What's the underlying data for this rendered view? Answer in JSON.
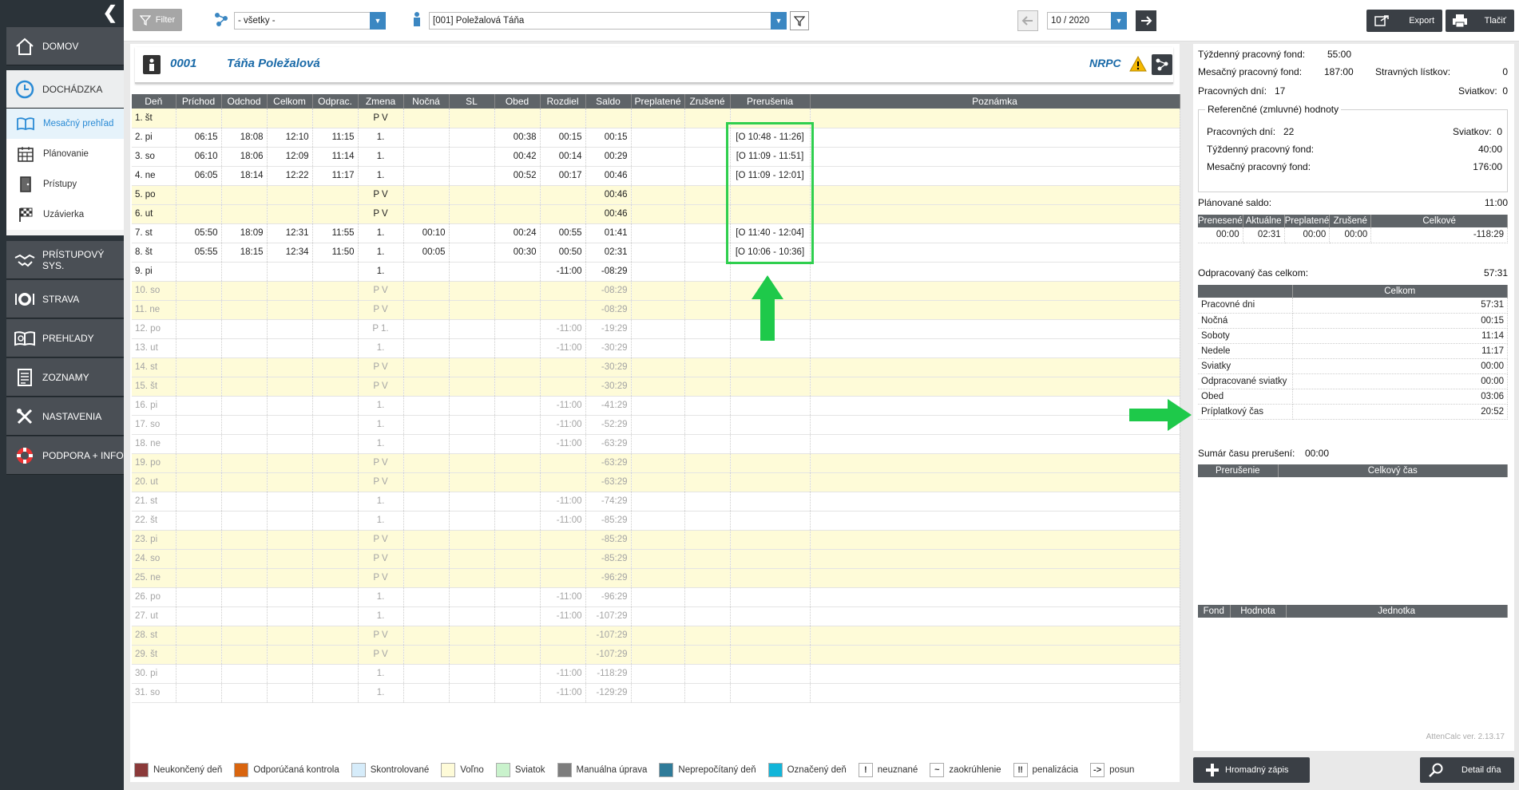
{
  "sidebar": {
    "home": "DOMOV",
    "attendance": "DOCHÁDZKA",
    "sub_items": [
      "Mesačný prehľad",
      "Plánovanie",
      "Prístupy",
      "Uzávierka"
    ],
    "access": "PRÍSTUPOVÝ SYS.",
    "food": "STRAVA",
    "overviews": "PREHĽADY",
    "lists": "ZOZNAMY",
    "settings": "NASTAVENIA",
    "support": "PODPORA + INFO"
  },
  "toolbar": {
    "filter_label": "Filter",
    "group_value": "- všetky -",
    "employee_value": "[001] Poležalová Táňa",
    "period_value": "10 / 2020",
    "export_label": "Export",
    "print_label": "Tlačiť"
  },
  "employee": {
    "id": "0001",
    "name": "Táňa Poležalová",
    "code": "NRPC"
  },
  "table": {
    "columns": [
      "Deň",
      "Príchod",
      "Odchod",
      "Celkom",
      "Odprac.",
      "Zmena",
      "Nočná",
      "SL",
      "Obed",
      "Rozdiel",
      "Saldo",
      "Preplatené",
      "Zrušené",
      "Prerušenia",
      "Poznámka"
    ],
    "rows": [
      {
        "d": "1. št",
        "pri": "",
        "odc": "",
        "cel": "",
        "odp": "",
        "zm": "P V",
        "no": "",
        "sl": "",
        "ob": "",
        "roz": "",
        "sal": "",
        "pre": "",
        "zr": "",
        "per": "",
        "poz": "",
        "t": "free"
      },
      {
        "d": "2. pi",
        "pri": "06:15",
        "odc": "18:08",
        "cel": "12:10",
        "odp": "11:15",
        "zm": "1.",
        "no": "",
        "sl": "",
        "ob": "00:38",
        "roz": "00:15",
        "sal": "00:15",
        "pre": "",
        "zr": "",
        "per": "[O 10:48 - 11:26]",
        "poz": "",
        "t": "work"
      },
      {
        "d": "3. so",
        "pri": "06:10",
        "odc": "18:06",
        "cel": "12:09",
        "odp": "11:14",
        "zm": "1.",
        "no": "",
        "sl": "",
        "ob": "00:42",
        "roz": "00:14",
        "sal": "00:29",
        "pre": "",
        "zr": "",
        "per": "[O 11:09 - 11:51]",
        "poz": "",
        "t": "work"
      },
      {
        "d": "4. ne",
        "pri": "06:05",
        "odc": "18:14",
        "cel": "12:22",
        "odp": "11:17",
        "zm": "1.",
        "no": "",
        "sl": "",
        "ob": "00:52",
        "roz": "00:17",
        "sal": "00:46",
        "pre": "",
        "zr": "",
        "per": "[O 11:09 - 12:01]",
        "poz": "",
        "t": "work"
      },
      {
        "d": "5. po",
        "pri": "",
        "odc": "",
        "cel": "",
        "odp": "",
        "zm": "P V",
        "no": "",
        "sl": "",
        "ob": "",
        "roz": "",
        "sal": "00:46",
        "pre": "",
        "zr": "",
        "per": "",
        "poz": "",
        "t": "free"
      },
      {
        "d": "6. ut",
        "pri": "",
        "odc": "",
        "cel": "",
        "odp": "",
        "zm": "P V",
        "no": "",
        "sl": "",
        "ob": "",
        "roz": "",
        "sal": "00:46",
        "pre": "",
        "zr": "",
        "per": "",
        "poz": "",
        "t": "free"
      },
      {
        "d": "7. st",
        "pri": "05:50",
        "odc": "18:09",
        "cel": "12:31",
        "odp": "11:55",
        "zm": "1.",
        "no": "00:10",
        "sl": "",
        "ob": "00:24",
        "roz": "00:55",
        "sal": "01:41",
        "pre": "",
        "zr": "",
        "per": "[O 11:40 - 12:04]",
        "poz": "",
        "t": "work"
      },
      {
        "d": "8. št",
        "pri": "05:55",
        "odc": "18:15",
        "cel": "12:34",
        "odp": "11:50",
        "zm": "1.",
        "no": "00:05",
        "sl": "",
        "ob": "00:30",
        "roz": "00:50",
        "sal": "02:31",
        "pre": "",
        "zr": "",
        "per": "[O 10:06 - 10:36]",
        "poz": "",
        "t": "work"
      },
      {
        "d": "9. pi",
        "pri": "",
        "odc": "",
        "cel": "",
        "odp": "",
        "zm": "1.",
        "no": "",
        "sl": "",
        "ob": "",
        "roz": "-11:00",
        "sal": "-08:29",
        "pre": "",
        "zr": "",
        "per": "",
        "poz": "",
        "t": "work"
      },
      {
        "d": "10. so",
        "pri": "",
        "odc": "",
        "cel": "",
        "odp": "",
        "zm": "P V",
        "no": "",
        "sl": "",
        "ob": "",
        "roz": "",
        "sal": "-08:29",
        "pre": "",
        "zr": "",
        "per": "",
        "poz": "",
        "t": "free future"
      },
      {
        "d": "11. ne",
        "pri": "",
        "odc": "",
        "cel": "",
        "odp": "",
        "zm": "P V",
        "no": "",
        "sl": "",
        "ob": "",
        "roz": "",
        "sal": "-08:29",
        "pre": "",
        "zr": "",
        "per": "",
        "poz": "",
        "t": "free future"
      },
      {
        "d": "12. po",
        "pri": "",
        "odc": "",
        "cel": "",
        "odp": "",
        "zm": "P 1.",
        "no": "",
        "sl": "",
        "ob": "",
        "roz": "-11:00",
        "sal": "-19:29",
        "pre": "",
        "zr": "",
        "per": "",
        "poz": "",
        "t": "future"
      },
      {
        "d": "13. ut",
        "pri": "",
        "odc": "",
        "cel": "",
        "odp": "",
        "zm": "1.",
        "no": "",
        "sl": "",
        "ob": "",
        "roz": "-11:00",
        "sal": "-30:29",
        "pre": "",
        "zr": "",
        "per": "",
        "poz": "",
        "t": "future"
      },
      {
        "d": "14. st",
        "pri": "",
        "odc": "",
        "cel": "",
        "odp": "",
        "zm": "P V",
        "no": "",
        "sl": "",
        "ob": "",
        "roz": "",
        "sal": "-30:29",
        "pre": "",
        "zr": "",
        "per": "",
        "poz": "",
        "t": "free future"
      },
      {
        "d": "15. št",
        "pri": "",
        "odc": "",
        "cel": "",
        "odp": "",
        "zm": "P V",
        "no": "",
        "sl": "",
        "ob": "",
        "roz": "",
        "sal": "-30:29",
        "pre": "",
        "zr": "",
        "per": "",
        "poz": "",
        "t": "free future"
      },
      {
        "d": "16. pi",
        "pri": "",
        "odc": "",
        "cel": "",
        "odp": "",
        "zm": "1.",
        "no": "",
        "sl": "",
        "ob": "",
        "roz": "-11:00",
        "sal": "-41:29",
        "pre": "",
        "zr": "",
        "per": "",
        "poz": "",
        "t": "future"
      },
      {
        "d": "17. so",
        "pri": "",
        "odc": "",
        "cel": "",
        "odp": "",
        "zm": "1.",
        "no": "",
        "sl": "",
        "ob": "",
        "roz": "-11:00",
        "sal": "-52:29",
        "pre": "",
        "zr": "",
        "per": "",
        "poz": "",
        "t": "future"
      },
      {
        "d": "18. ne",
        "pri": "",
        "odc": "",
        "cel": "",
        "odp": "",
        "zm": "1.",
        "no": "",
        "sl": "",
        "ob": "",
        "roz": "-11:00",
        "sal": "-63:29",
        "pre": "",
        "zr": "",
        "per": "",
        "poz": "",
        "t": "future"
      },
      {
        "d": "19. po",
        "pri": "",
        "odc": "",
        "cel": "",
        "odp": "",
        "zm": "P V",
        "no": "",
        "sl": "",
        "ob": "",
        "roz": "",
        "sal": "-63:29",
        "pre": "",
        "zr": "",
        "per": "",
        "poz": "",
        "t": "free future"
      },
      {
        "d": "20. ut",
        "pri": "",
        "odc": "",
        "cel": "",
        "odp": "",
        "zm": "P V",
        "no": "",
        "sl": "",
        "ob": "",
        "roz": "",
        "sal": "-63:29",
        "pre": "",
        "zr": "",
        "per": "",
        "poz": "",
        "t": "free future"
      },
      {
        "d": "21. st",
        "pri": "",
        "odc": "",
        "cel": "",
        "odp": "",
        "zm": "1.",
        "no": "",
        "sl": "",
        "ob": "",
        "roz": "-11:00",
        "sal": "-74:29",
        "pre": "",
        "zr": "",
        "per": "",
        "poz": "",
        "t": "future"
      },
      {
        "d": "22. št",
        "pri": "",
        "odc": "",
        "cel": "",
        "odp": "",
        "zm": "1.",
        "no": "",
        "sl": "",
        "ob": "",
        "roz": "-11:00",
        "sal": "-85:29",
        "pre": "",
        "zr": "",
        "per": "",
        "poz": "",
        "t": "future"
      },
      {
        "d": "23. pi",
        "pri": "",
        "odc": "",
        "cel": "",
        "odp": "",
        "zm": "P V",
        "no": "",
        "sl": "",
        "ob": "",
        "roz": "",
        "sal": "-85:29",
        "pre": "",
        "zr": "",
        "per": "",
        "poz": "",
        "t": "free future"
      },
      {
        "d": "24. so",
        "pri": "",
        "odc": "",
        "cel": "",
        "odp": "",
        "zm": "P V",
        "no": "",
        "sl": "",
        "ob": "",
        "roz": "",
        "sal": "-85:29",
        "pre": "",
        "zr": "",
        "per": "",
        "poz": "",
        "t": "free future"
      },
      {
        "d": "25. ne",
        "pri": "",
        "odc": "",
        "cel": "",
        "odp": "",
        "zm": "P V",
        "no": "",
        "sl": "",
        "ob": "",
        "roz": "",
        "sal": "-96:29",
        "pre": "",
        "zr": "",
        "per": "",
        "poz": "",
        "t": "free future"
      },
      {
        "d": "26. po",
        "pri": "",
        "odc": "",
        "cel": "",
        "odp": "",
        "zm": "1.",
        "no": "",
        "sl": "",
        "ob": "",
        "roz": "-11:00",
        "sal": "-96:29",
        "pre": "",
        "zr": "",
        "per": "",
        "poz": "",
        "t": "future"
      },
      {
        "d": "27. ut",
        "pri": "",
        "odc": "",
        "cel": "",
        "odp": "",
        "zm": "1.",
        "no": "",
        "sl": "",
        "ob": "",
        "roz": "-11:00",
        "sal": "-107:29",
        "pre": "",
        "zr": "",
        "per": "",
        "poz": "",
        "t": "future"
      },
      {
        "d": "28. st",
        "pri": "",
        "odc": "",
        "cel": "",
        "odp": "",
        "zm": "P V",
        "no": "",
        "sl": "",
        "ob": "",
        "roz": "",
        "sal": "-107:29",
        "pre": "",
        "zr": "",
        "per": "",
        "poz": "",
        "t": "free future"
      },
      {
        "d": "29. št",
        "pri": "",
        "odc": "",
        "cel": "",
        "odp": "",
        "zm": "P V",
        "no": "",
        "sl": "",
        "ob": "",
        "roz": "",
        "sal": "-107:29",
        "pre": "",
        "zr": "",
        "per": "",
        "poz": "",
        "t": "free future"
      },
      {
        "d": "30. pi",
        "pri": "",
        "odc": "",
        "cel": "",
        "odp": "",
        "zm": "1.",
        "no": "",
        "sl": "",
        "ob": "",
        "roz": "-11:00",
        "sal": "-118:29",
        "pre": "",
        "zr": "",
        "per": "",
        "poz": "",
        "t": "future"
      },
      {
        "d": "31. so",
        "pri": "",
        "odc": "",
        "cel": "",
        "odp": "",
        "zm": "1.",
        "no": "",
        "sl": "",
        "ob": "",
        "roz": "-11:00",
        "sal": "-129:29",
        "pre": "",
        "zr": "",
        "per": "",
        "poz": "",
        "t": "future"
      }
    ]
  },
  "legend": [
    {
      "label": "Neukončený deň",
      "color": "#8b3a3a",
      "mark": ""
    },
    {
      "label": "Odporúčaná kontrola",
      "color": "#d9650f",
      "mark": ""
    },
    {
      "label": "Skontrolované",
      "color": "#d6ecfa",
      "mark": ""
    },
    {
      "label": "Voľno",
      "color": "#fefbd8",
      "mark": ""
    },
    {
      "label": "Sviatok",
      "color": "#c9f2cc",
      "mark": ""
    },
    {
      "label": "Manuálna úprava",
      "color": "#7d7d7d",
      "mark": ""
    },
    {
      "label": "Neprepočítaný deň",
      "color": "#2f7b99",
      "mark": ""
    },
    {
      "label": "Označený deň",
      "color": "#12b5d9",
      "mark": ""
    },
    {
      "label": "neuznané",
      "color": "#ffffff",
      "mark": "!"
    },
    {
      "label": "zaokrúhlenie",
      "color": "#ffffff",
      "mark": "~"
    },
    {
      "label": "penalizácia",
      "color": "#ffffff",
      "mark": "‼"
    },
    {
      "label": "posun",
      "color": "#ffffff",
      "mark": "->"
    }
  ],
  "summary": {
    "weekly_fund_label": "Týždenný pracovný fond:",
    "weekly_fund_value": "55:00",
    "monthly_fund_label": "Mesačný pracovný fond:",
    "monthly_fund_value": "187:00",
    "meal_label": "Stravných lístkov:",
    "meal_value": "0",
    "workdays_label": "Pracovných dní:",
    "workdays_value": "17",
    "holidays_label": "Sviatkov:",
    "holidays_value": "0",
    "ref_title": "Referenčné (zmluvné) hodnoty",
    "ref_workdays_label": "Pracovných dní:",
    "ref_workdays_value": "22",
    "ref_holidays_label": "Sviatkov:",
    "ref_holidays_value": "0",
    "ref_weekly_label": "Týždenný pracovný fond:",
    "ref_weekly_value": "40:00",
    "ref_monthly_label": "Mesačný pracovný fond:",
    "ref_monthly_value": "176:00",
    "planned_label": "Plánované saldo:",
    "planned_value": "11:00",
    "saldo_cols": [
      "Prenesené",
      "Aktuálne",
      "Preplatené",
      "Zrušené",
      "Celkové"
    ],
    "saldo_vals": [
      "00:00",
      "02:31",
      "00:00",
      "00:00",
      "-118:29"
    ],
    "worked_label": "Odpracovaný čas celkom:",
    "worked_value": "57:31",
    "worked_col": "Celkom",
    "worked_rows": [
      {
        "k": "Pracovné dni",
        "v": "57:31"
      },
      {
        "k": "Nočná",
        "v": "00:15"
      },
      {
        "k": "Soboty",
        "v": "11:14"
      },
      {
        "k": "Nedele",
        "v": "11:17"
      },
      {
        "k": "Sviatky",
        "v": "00:00"
      },
      {
        "k": "Odpracované sviatky",
        "v": "00:00"
      },
      {
        "k": "Obed",
        "v": "03:06"
      },
      {
        "k": "Príplatkový čas",
        "v": "20:52"
      }
    ],
    "break_label": "Sumár času prerušení:",
    "break_value": "00:00",
    "break_cols": [
      "Prerušenie",
      "Celkový čas"
    ],
    "fund_cols": [
      "Fond",
      "Hodnota",
      "Jednotka"
    ],
    "version": "AttenCalc ver. 2.13.17"
  },
  "bottom": {
    "bulk_label": "Hromadný zápis",
    "detail_label": "Detail dňa"
  },
  "colors": {
    "accent": "#3b87c2",
    "highlight": "#2fcf4e",
    "header": "#5f6468"
  }
}
